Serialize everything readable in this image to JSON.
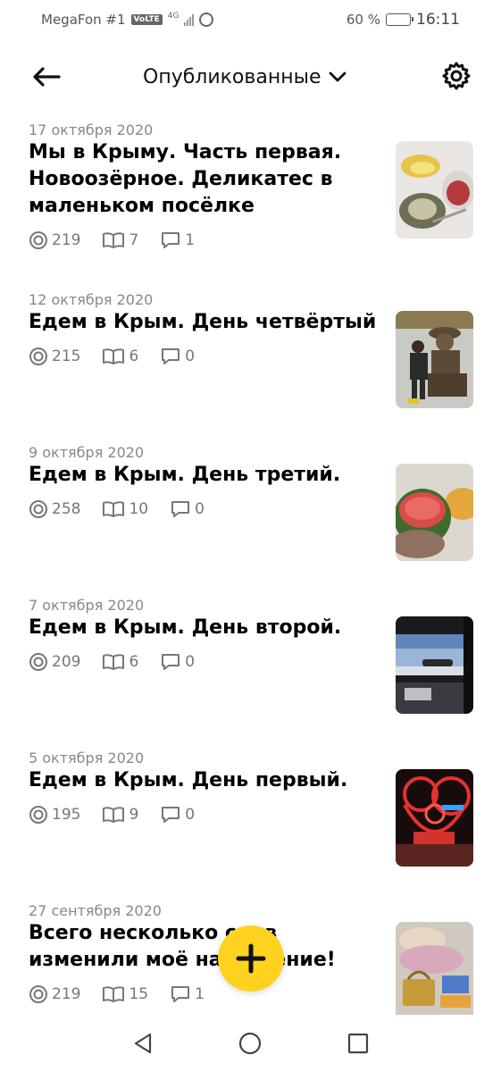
{
  "status_bar": {
    "carrier": "MegaFon #1",
    "volte": "VoLTE",
    "network": "4G",
    "battery_text": "60 %",
    "battery_level": 0.6,
    "time": "16:11"
  },
  "header": {
    "title": "Опубликованные",
    "icons": {
      "back": "arrow-left-icon",
      "dropdown": "chevron-down-icon",
      "settings": "gear-icon"
    }
  },
  "articles": [
    {
      "date": "17 октября 2020",
      "title": "Мы в Крыму. Часть первая. Новоозёрное. Деликатес в маленьком посёлке",
      "views": "219",
      "reads": "7",
      "comments": "1"
    },
    {
      "date": "12 октября 2020",
      "title": "Едем в Крым. День четвёртый",
      "views": "215",
      "reads": "6",
      "comments": "0"
    },
    {
      "date": "9 октября 2020",
      "title": "Едем в Крым. День третий.",
      "views": "258",
      "reads": "10",
      "comments": "0"
    },
    {
      "date": "7 октября 2020",
      "title": "Едем в Крым. День второй.",
      "views": "209",
      "reads": "6",
      "comments": "0"
    },
    {
      "date": "5 октября 2020",
      "title": "Едем в Крым. День первый.",
      "views": "195",
      "reads": "9",
      "comments": "0"
    },
    {
      "date": "27 сентября 2020",
      "title": "Всего несколько слов изменили моё настроение!",
      "views": "219",
      "reads": "15",
      "comments": "1"
    }
  ],
  "fab": {
    "icon": "plus-icon"
  },
  "colors": {
    "accent": "#ffd21f",
    "text_secondary": "#888888"
  }
}
